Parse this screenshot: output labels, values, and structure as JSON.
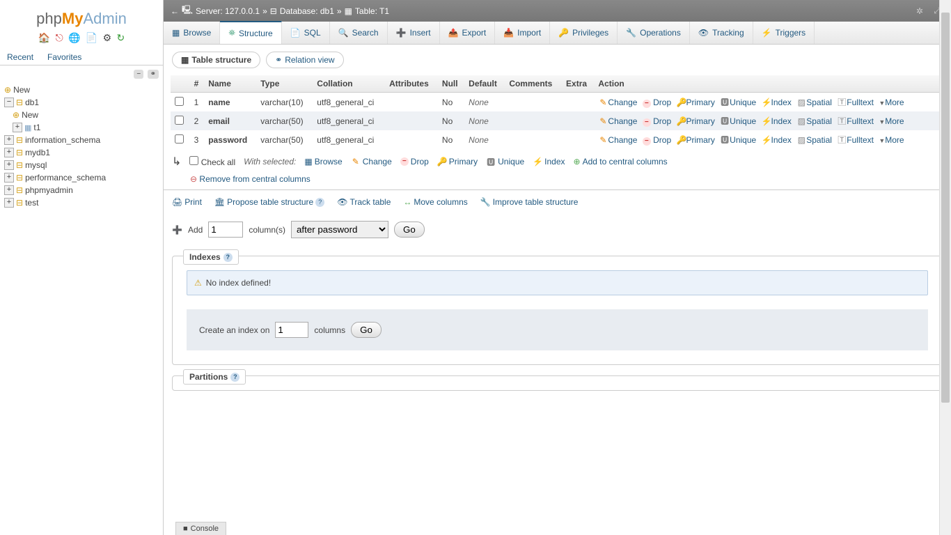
{
  "logo": {
    "p1": "php",
    "p2": "My",
    "p3": "Admin"
  },
  "sidebarTabs": {
    "recent": "Recent",
    "favorites": "Favorites"
  },
  "tree": {
    "new": "New",
    "db": "db1",
    "dbnew": "New",
    "t1": "t1",
    "items": [
      "information_schema",
      "mydb1",
      "mysql",
      "performance_schema",
      "phpmyadmin",
      "test"
    ]
  },
  "breadcrumb": {
    "server": "Server: 127.0.0.1",
    "db": "Database: db1",
    "tbl": "Table: T1"
  },
  "tabs": [
    "Browse",
    "Structure",
    "SQL",
    "Search",
    "Insert",
    "Export",
    "Import",
    "Privileges",
    "Operations",
    "Tracking",
    "Triggers"
  ],
  "subtabs": {
    "ts": "Table structure",
    "rv": "Relation view"
  },
  "cols": {
    "num": "#",
    "name": "Name",
    "type": "Type",
    "coll": "Collation",
    "attr": "Attributes",
    "null": "Null",
    "def": "Default",
    "comm": "Comments",
    "extra": "Extra",
    "action": "Action"
  },
  "rows": [
    {
      "n": "1",
      "name": "name",
      "type": "varchar(10)",
      "coll": "utf8_general_ci",
      "null": "No",
      "def": "None"
    },
    {
      "n": "2",
      "name": "email",
      "type": "varchar(50)",
      "coll": "utf8_general_ci",
      "null": "No",
      "def": "None"
    },
    {
      "n": "3",
      "name": "password",
      "type": "varchar(50)",
      "coll": "utf8_general_ci",
      "null": "No",
      "def": "None"
    }
  ],
  "actions": {
    "change": "Change",
    "drop": "Drop",
    "primary": "Primary",
    "unique": "Unique",
    "index": "Index",
    "spatial": "Spatial",
    "fulltext": "Fulltext",
    "more": "More"
  },
  "checkall": {
    "label": "Check all",
    "with": "With selected:",
    "browse": "Browse",
    "change": "Change",
    "drop": "Drop",
    "primary": "Primary",
    "unique": "Unique",
    "index": "Index",
    "addcc": "Add to central columns",
    "remcc": "Remove from central columns"
  },
  "links": {
    "print": "Print",
    "propose": "Propose table structure",
    "track": "Track table",
    "move": "Move columns",
    "improve": "Improve table structure"
  },
  "addcol": {
    "add": "Add",
    "val": "1",
    "cols": "column(s)",
    "pos": "after password",
    "go": "Go"
  },
  "indexes": {
    "title": "Indexes",
    "none": "No index defined!",
    "create": "Create an index on",
    "val": "1",
    "cols": "columns",
    "go": "Go"
  },
  "partitions": {
    "title": "Partitions"
  },
  "console": "Console"
}
